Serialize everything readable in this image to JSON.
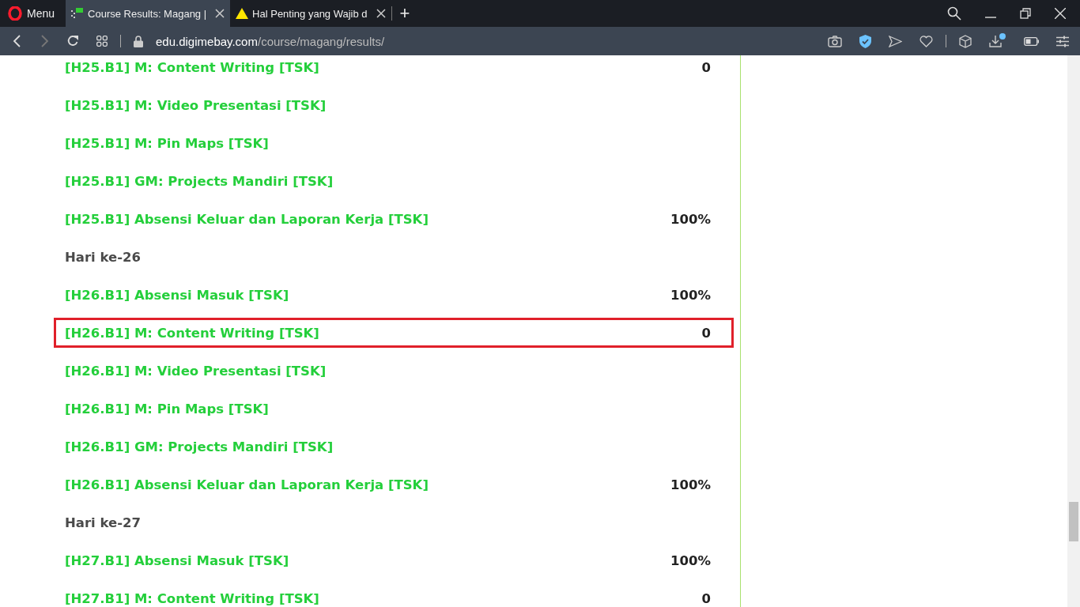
{
  "browser": {
    "menu_label": "Menu",
    "tabs": [
      {
        "title": "Course Results: Magang |",
        "selected": true,
        "kind": "course"
      },
      {
        "title": "Hal Penting yang Wajib d",
        "selected": false,
        "kind": "warning"
      }
    ],
    "new_tab": "+",
    "url_host": "edu.digimebay.com",
    "url_path": "/course/magang/results/"
  },
  "results": [
    {
      "kind": "task",
      "label": "[H25.B1] M: Content Writing [TSK]",
      "score": "0",
      "highlighted": false
    },
    {
      "kind": "task",
      "label": "[H25.B1] M: Video Presentasi [TSK]",
      "highlighted": false
    },
    {
      "kind": "task",
      "label": "[H25.B1] M: Pin Maps [TSK]",
      "highlighted": false
    },
    {
      "kind": "task",
      "label": "[H25.B1] GM: Projects Mandiri [TSK]",
      "highlighted": false
    },
    {
      "kind": "task",
      "label": "[H25.B1] Absensi Keluar dan Laporan Kerja [TSK]",
      "score": "100%",
      "highlighted": false
    },
    {
      "kind": "heading",
      "label": "Hari ke-26"
    },
    {
      "kind": "task",
      "label": "[H26.B1] Absensi Masuk [TSK]",
      "score": "100%",
      "highlighted": false
    },
    {
      "kind": "task",
      "label": "[H26.B1] M: Content Writing [TSK]",
      "score": "0",
      "highlighted": true
    },
    {
      "kind": "task",
      "label": "[H26.B1] M: Video Presentasi [TSK]",
      "highlighted": false
    },
    {
      "kind": "task",
      "label": "[H26.B1] M: Pin Maps [TSK]",
      "highlighted": false
    },
    {
      "kind": "task",
      "label": "[H26.B1] GM: Projects Mandiri [TSK]",
      "highlighted": false
    },
    {
      "kind": "task",
      "label": "[H26.B1] Absensi Keluar dan Laporan Kerja [TSK]",
      "score": "100%",
      "highlighted": false
    },
    {
      "kind": "heading",
      "label": "Hari ke-27"
    },
    {
      "kind": "task",
      "label": "[H27.B1] Absensi Masuk [TSK]",
      "score": "100%",
      "highlighted": false
    },
    {
      "kind": "task",
      "label": "[H27.B1] M: Content Writing [TSK]",
      "score": "0",
      "highlighted": false
    }
  ]
}
